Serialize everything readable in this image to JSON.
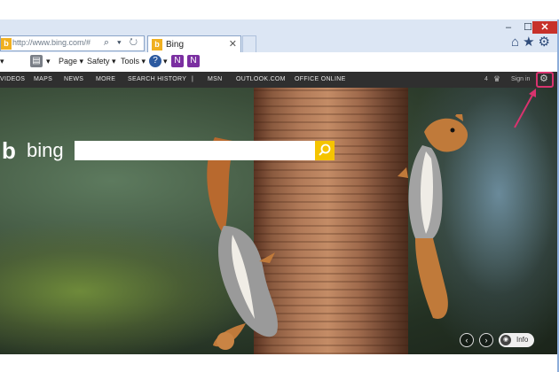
{
  "window": {
    "minimize": "–",
    "maximize": "☐",
    "close": "✕"
  },
  "address_bar": {
    "url": "http://www.bing.com/#",
    "icons": "⌕ ▾ ↻"
  },
  "tab": {
    "logo": "b",
    "title": "Bing",
    "close": "✕"
  },
  "toolbar_icons": {
    "home": "⌂",
    "favorites": "★",
    "settings": "⚙"
  },
  "command_bar": {
    "page": "Page ▾",
    "safety": "Safety ▾",
    "tools": "Tools ▾",
    "help": "?"
  },
  "bing_nav": {
    "items": [
      "VIDEOS",
      "MAPS",
      "NEWS",
      "MORE",
      "SEARCH HISTORY",
      "|",
      "MSN",
      "OUTLOOK.COM",
      "OFFICE ONLINE"
    ],
    "count": "4",
    "sign_in": "Sign in"
  },
  "bing": {
    "logo_mark": "b",
    "logo_text": "bing",
    "search_placeholder": ""
  },
  "controls": {
    "prev": "‹",
    "next": "›",
    "info": "Info",
    "camera": "◉"
  },
  "colors": {
    "search_button": "#f5c400",
    "highlight": "#d8336e"
  }
}
